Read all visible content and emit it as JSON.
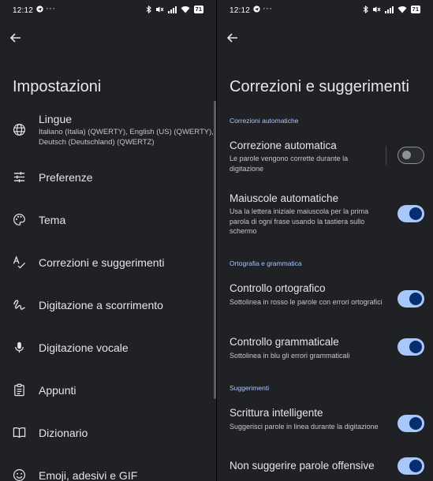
{
  "status": {
    "time": "12:12",
    "dots": "···",
    "battery": "71"
  },
  "left": {
    "title": "Impostazioni",
    "items": [
      {
        "label": "Lingue",
        "subtitle": "Italiano (Italia) (QWERTY), English (US) (QWERTY), Deutsch (Deutschland) (QWERTZ)",
        "icon": "globe-icon"
      },
      {
        "label": "Preferenze",
        "icon": "tune-icon"
      },
      {
        "label": "Tema",
        "icon": "palette-icon"
      },
      {
        "label": "Correzioni e suggerimenti",
        "icon": "spellcheck-icon"
      },
      {
        "label": "Digitazione a scorrimento",
        "icon": "gesture-icon"
      },
      {
        "label": "Digitazione vocale",
        "icon": "mic-icon"
      },
      {
        "label": "Appunti",
        "icon": "clipboard-icon"
      },
      {
        "label": "Dizionario",
        "icon": "book-icon"
      },
      {
        "label": "Emoji, adesivi e GIF",
        "icon": "emoji-icon"
      }
    ]
  },
  "right": {
    "title": "Correzioni e suggerimenti",
    "sections": [
      "Correzioni automatiche",
      "Ortografia e grammatica",
      "Suggerimenti"
    ],
    "settings": [
      {
        "title": "Correzione automatica",
        "desc": "Le parole vengono corrette durante la digitazione",
        "enabled": false
      },
      {
        "title": "Maiuscole automatiche",
        "desc": "Usa la lettera iniziale maiuscola per la prima parola di ogni frase usando la tastiera sullo schermo",
        "enabled": true
      },
      {
        "title": "Controllo ortografico",
        "desc": "Sottolinea in rosso le parole con errori ortografici",
        "enabled": true
      },
      {
        "title": "Controllo grammaticale",
        "desc": "Sottolinea in blu gli errori grammaticali",
        "enabled": true
      },
      {
        "title": "Scrittura intelligente",
        "desc": "Suggerisci parole in linea durante la digitazione",
        "enabled": true
      },
      {
        "title": "Non suggerire parole offensive",
        "desc": "",
        "enabled": true
      }
    ]
  },
  "colors": {
    "background": "#202124",
    "accent": "#a8c7fa",
    "toggle_knob_on": "#062e6f"
  }
}
